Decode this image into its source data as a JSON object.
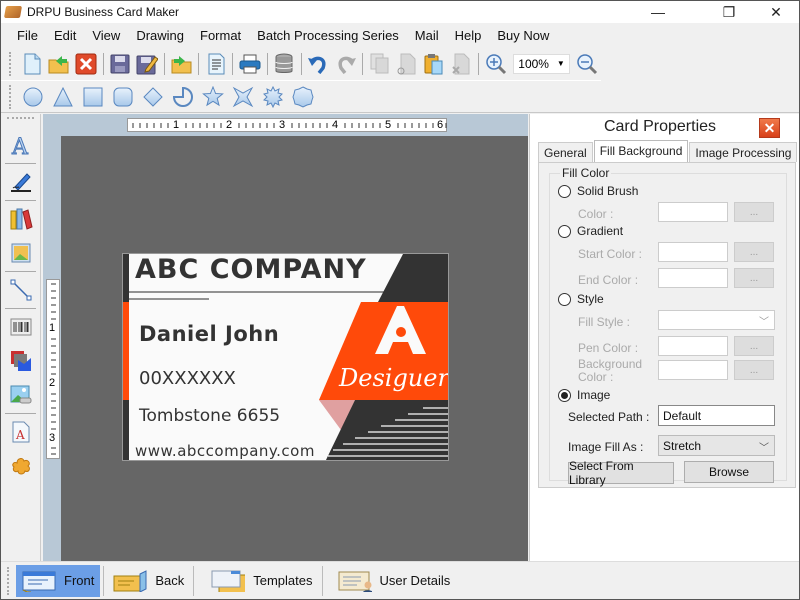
{
  "window": {
    "title": "DRPU Business Card Maker",
    "controls": {
      "minimize": "—",
      "maximize": "❐",
      "close": "✕"
    }
  },
  "menu": [
    "File",
    "Edit",
    "View",
    "Drawing",
    "Format",
    "Batch Processing Series",
    "Mail",
    "Help",
    "Buy Now"
  ],
  "toolbar": {
    "buttons": [
      "new-icon",
      "open-icon",
      "close-icon",
      "save-icon",
      "save-as-icon",
      "open-template-icon",
      "print-preview-icon",
      "print-icon",
      "database-icon",
      "undo-icon",
      "redo-icon",
      "copy-icon",
      "cut-icon",
      "paste-icon",
      "delete-icon",
      "zoom-in-icon",
      "zoom-out-icon"
    ],
    "zoom_value": "100%"
  },
  "shapes_toolbar": [
    "ellipse",
    "triangle",
    "rectangle",
    "rounded-rectangle",
    "diamond",
    "pie",
    "star-5",
    "star-4",
    "burst",
    "polygon"
  ],
  "left_tools": [
    "text",
    "signature",
    "library",
    "image",
    "line",
    "barcode",
    "shapes",
    "picture",
    "watermark",
    "symbol"
  ],
  "ruler": {
    "horizontal_marks": [
      "1",
      "2",
      "3",
      "4",
      "5",
      "6"
    ],
    "vertical_marks": [
      "1",
      "2",
      "3"
    ]
  },
  "card": {
    "company": "ABC COMPANY",
    "name": "Daniel John",
    "phone": "00XXXXXX",
    "address": "Tombstone 6655",
    "website": "www.abccompany.com",
    "logo_text": "Desiguer",
    "colors": {
      "accent": "#ff4a0a",
      "dark": "#333333",
      "light": "#fafafa"
    }
  },
  "properties": {
    "title": "Card Properties",
    "tabs": [
      "General",
      "Fill Background",
      "Image Processing"
    ],
    "active_tab": "Fill Background",
    "group_label": "Fill Color",
    "solid_brush": {
      "label": "Solid Brush",
      "color_label": "Color :",
      "button": "..."
    },
    "gradient": {
      "label": "Gradient",
      "start_label": "Start Color :",
      "end_label": "End Color :",
      "button": "..."
    },
    "style": {
      "label": "Style",
      "fill_style_label": "Fill Style :",
      "pen_color_label": "Pen Color :",
      "bg_color_label_1": "Background",
      "bg_color_label_2": "Color :",
      "button": "..."
    },
    "image": {
      "label": "Image",
      "checked": true,
      "selected_path_label": "Selected Path :",
      "selected_path_value": "Default",
      "fill_as_label": "Image Fill As :",
      "fill_as_value": "Stretch",
      "library_button": "Select From Library",
      "browse_button": "Browse"
    }
  },
  "bottom_bar": {
    "buttons": [
      "Front",
      "Back",
      "Templates",
      "User Details"
    ],
    "active": "Front"
  }
}
